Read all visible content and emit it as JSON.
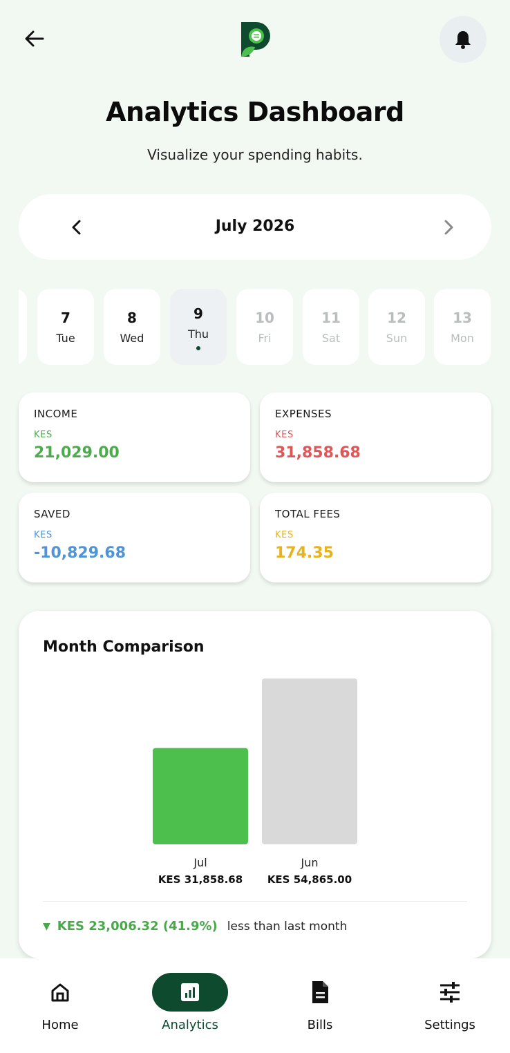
{
  "header": {
    "title": "Analytics Dashboard",
    "subtitle": "Visualize your spending habits."
  },
  "month": {
    "label": "July 2026"
  },
  "days": [
    {
      "num": "7",
      "dow": "Tue",
      "state": "past"
    },
    {
      "num": "8",
      "dow": "Wed",
      "state": "past"
    },
    {
      "num": "9",
      "dow": "Thu",
      "state": "selected"
    },
    {
      "num": "10",
      "dow": "Fri",
      "state": "future"
    },
    {
      "num": "11",
      "dow": "Sat",
      "state": "future"
    },
    {
      "num": "12",
      "dow": "Sun",
      "state": "future"
    },
    {
      "num": "13",
      "dow": "Mon",
      "state": "future"
    }
  ],
  "stats": {
    "income": {
      "label": "INCOME",
      "currency": "KES",
      "value": "21,029.00",
      "color": "#4cab4c"
    },
    "expenses": {
      "label": "EXPENSES",
      "currency": "KES",
      "value": "31,858.68",
      "color": "#e05555"
    },
    "saved": {
      "label": "SAVED",
      "currency": "KES",
      "value": "-10,829.68",
      "color": "#4f93d8"
    },
    "fees": {
      "label": "TOTAL FEES",
      "currency": "KES",
      "value": "174.35",
      "color": "#e8b21c"
    }
  },
  "comparison": {
    "title": "Month Comparison",
    "footer_diff": "KES 23,006.32 (41.9%)",
    "footer_rest": "less than last month",
    "footer_icon": "triangle-down-icon"
  },
  "chart_data": {
    "type": "bar",
    "categories": [
      "Jul",
      "Jun"
    ],
    "values": [
      31858.68,
      54865.0
    ],
    "value_labels": [
      "KES 31,858.68",
      "KES 54,865.00"
    ],
    "colors": [
      "#4cbf4c",
      "#d9d9d9"
    ],
    "title": "Month Comparison"
  },
  "nav": [
    {
      "label": "Home",
      "icon": "home-icon",
      "active": false
    },
    {
      "label": "Analytics",
      "icon": "analytics-icon",
      "active": true
    },
    {
      "label": "Bills",
      "icon": "document-icon",
      "active": false
    },
    {
      "label": "Settings",
      "icon": "sliders-icon",
      "active": false
    }
  ],
  "colors": {
    "brand_dark": "#0d4a2e",
    "brand_green": "#4cbf4c",
    "background": "#f2f9f3"
  }
}
